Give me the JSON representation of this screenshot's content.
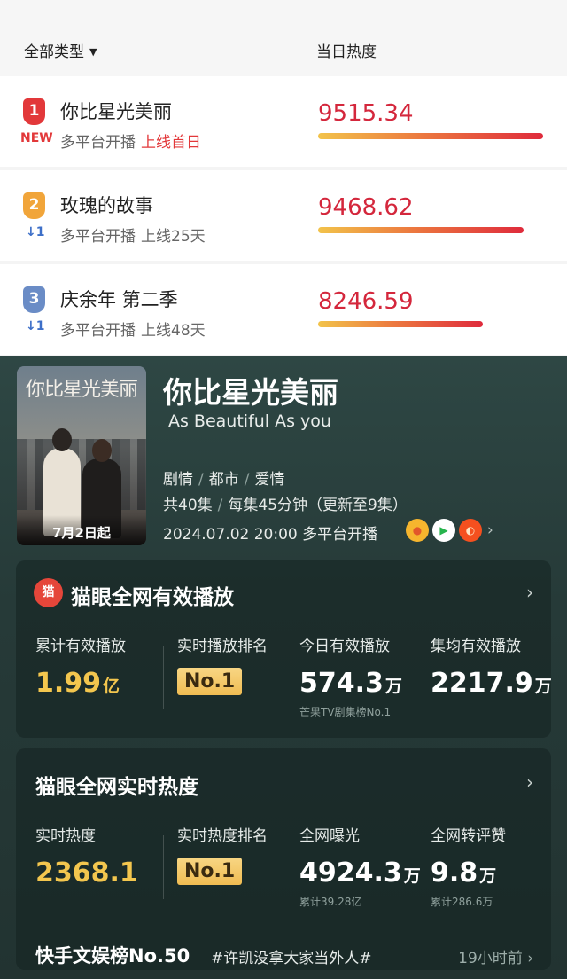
{
  "list_header": {
    "filter_label": "全部类型",
    "heat_column": "当日热度"
  },
  "ranking": [
    {
      "rank": "1",
      "change": "NEW",
      "title": "你比星光美丽",
      "platform": "多平台开播",
      "days": "上线首日",
      "heat": "9515.34"
    },
    {
      "rank": "2",
      "change": "↓1",
      "title": "玫瑰的故事",
      "platform": "多平台开播",
      "days": "上线25天",
      "heat": "9468.62"
    },
    {
      "rank": "3",
      "change": "↓1",
      "title": "庆余年 第二季",
      "platform": "多平台开播",
      "days": "上线48天",
      "heat": "8246.59"
    }
  ],
  "detail": {
    "poster": {
      "title": "你比星光美丽",
      "date_tag": "7月2日起"
    },
    "title": "你比星光美丽",
    "title_en": "As Beautiful As you",
    "genres": [
      "剧情",
      "都市",
      "爱情"
    ],
    "episodes": "共40集",
    "duration": "每集45分钟（更新至9集）",
    "airtime": "2024.07.02 20:00 多平台开播",
    "platforms": [
      "mango-tv-icon",
      "iqiyi-icon",
      "youku-icon"
    ]
  },
  "playback_card": {
    "icon_text": "猫",
    "title": "猫眼全网有效播放",
    "stats": [
      {
        "label": "累计有效播放",
        "value": "1.99",
        "unit": "亿"
      },
      {
        "label": "实时播放排名",
        "value": "No.1"
      },
      {
        "label": "今日有效播放",
        "value": "574.3",
        "unit": "万",
        "note": "芒果TV剧集榜No.1"
      },
      {
        "label": "集均有效播放",
        "value": "2217.9",
        "unit": "万"
      }
    ]
  },
  "heat_card": {
    "title": "猫眼全网实时热度",
    "stats": [
      {
        "label": "实时热度",
        "value": "2368.1"
      },
      {
        "label": "实时热度排名",
        "value": "No.1"
      },
      {
        "label": "全网曝光",
        "value": "4924.3",
        "unit": "万",
        "note": "累计39.28亿"
      },
      {
        "label": "全网转评赞",
        "value": "9.8",
        "unit": "万",
        "note": "累计286.6万"
      }
    ],
    "kuaishou": {
      "label": "快手文娱榜No.50",
      "tag": "#许凯没拿大家当外人#",
      "time": "19小时前"
    }
  },
  "colors": {
    "accent_red": "#d4273c",
    "rank1": "#e2383a",
    "rank2": "#f1a53a",
    "rank3": "#6a8cc6",
    "gold": "#f3c64e",
    "panel_bg": "#2e4744"
  }
}
